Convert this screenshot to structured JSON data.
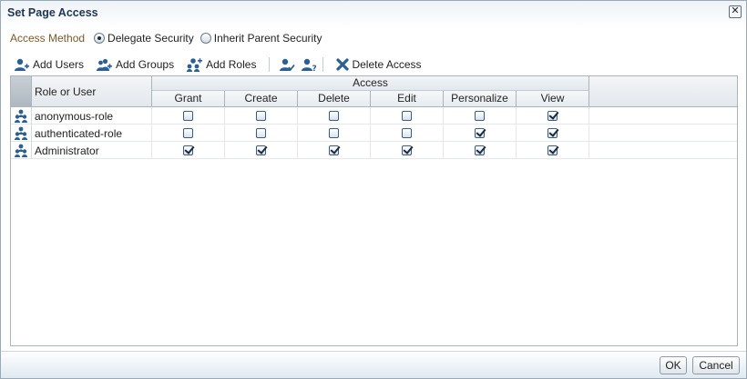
{
  "dialog": {
    "title": "Set Page Access",
    "close_glyph": "✕"
  },
  "access_method": {
    "label": "Access Method",
    "options": [
      {
        "label": "Delegate Security",
        "selected": true
      },
      {
        "label": "Inherit Parent Security",
        "selected": false
      }
    ]
  },
  "toolbar": {
    "add_users": "Add Users",
    "add_groups": "Add Groups",
    "add_roles": "Add Roles",
    "delete_access": "Delete Access",
    "icon_color": "#2c5f93"
  },
  "table": {
    "header_role": "Role or User",
    "header_access": "Access",
    "columns": [
      "Grant",
      "Create",
      "Delete",
      "Edit",
      "Personalize",
      "View"
    ],
    "rows": [
      {
        "name": "anonymous-role",
        "checks": [
          false,
          false,
          false,
          false,
          false,
          true
        ]
      },
      {
        "name": "authenticated-role",
        "checks": [
          false,
          false,
          false,
          false,
          true,
          true
        ]
      },
      {
        "name": "Administrator",
        "checks": [
          true,
          true,
          true,
          true,
          true,
          true
        ]
      }
    ]
  },
  "buttons": {
    "ok": "OK",
    "cancel": "Cancel"
  }
}
